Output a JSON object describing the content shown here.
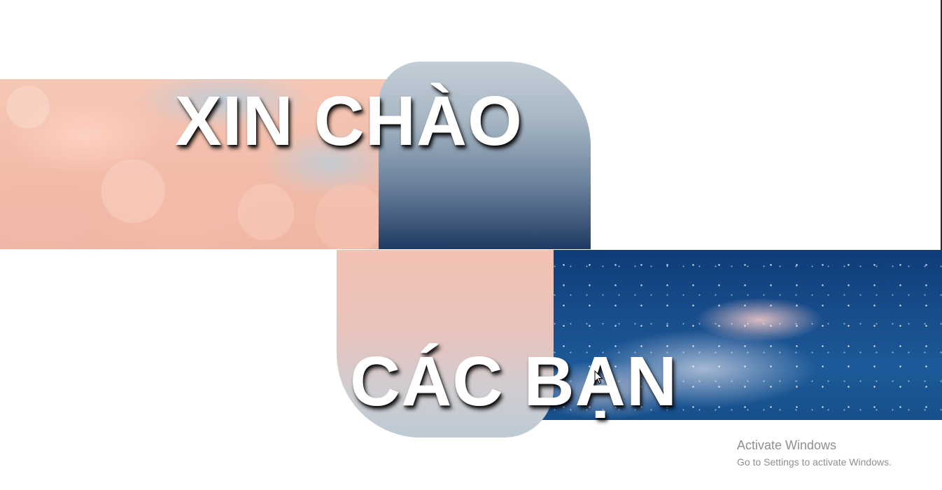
{
  "slide": {
    "heading_top": "XIN CHÀO",
    "heading_bottom": "CÁC BẠN"
  },
  "watermark": {
    "title": "Activate Windows",
    "subtitle": "Go to Settings to activate Windows."
  },
  "icons": {
    "cursor": "mouse-pointer-icon"
  },
  "colors": {
    "pink": "#f2c2b2",
    "slate_top": "#c3ced7",
    "navy": "#1f3a63",
    "sky": "#1a4f8e",
    "text": "#ffffff",
    "watermark": "#8f8f8f"
  }
}
